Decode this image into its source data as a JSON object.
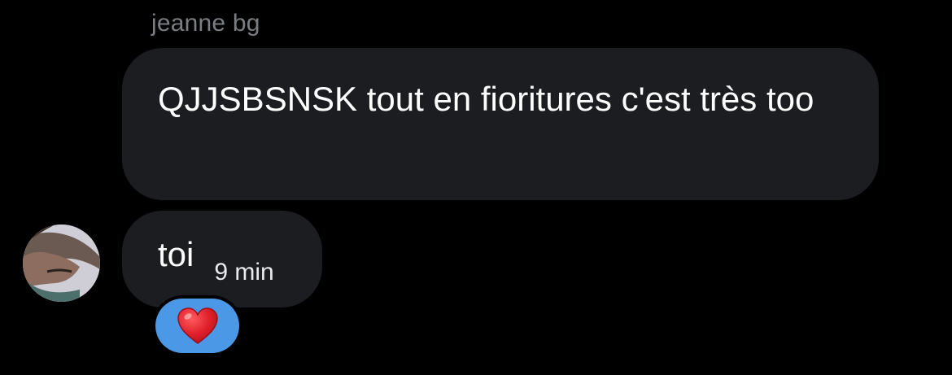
{
  "conversation": {
    "sender_name": "jeanne bg",
    "messages": [
      {
        "text": "QJJSBSNSK tout en fioritures c'est très too"
      },
      {
        "text": "toi",
        "timestamp": "9 min",
        "reaction": "heart-emoji-icon"
      }
    ]
  },
  "colors": {
    "background": "#000000",
    "bubble": "#1c1d20",
    "sender_name": "#7a7d82",
    "reaction_pill": "#4a98e6",
    "heart": "#e0202a"
  }
}
